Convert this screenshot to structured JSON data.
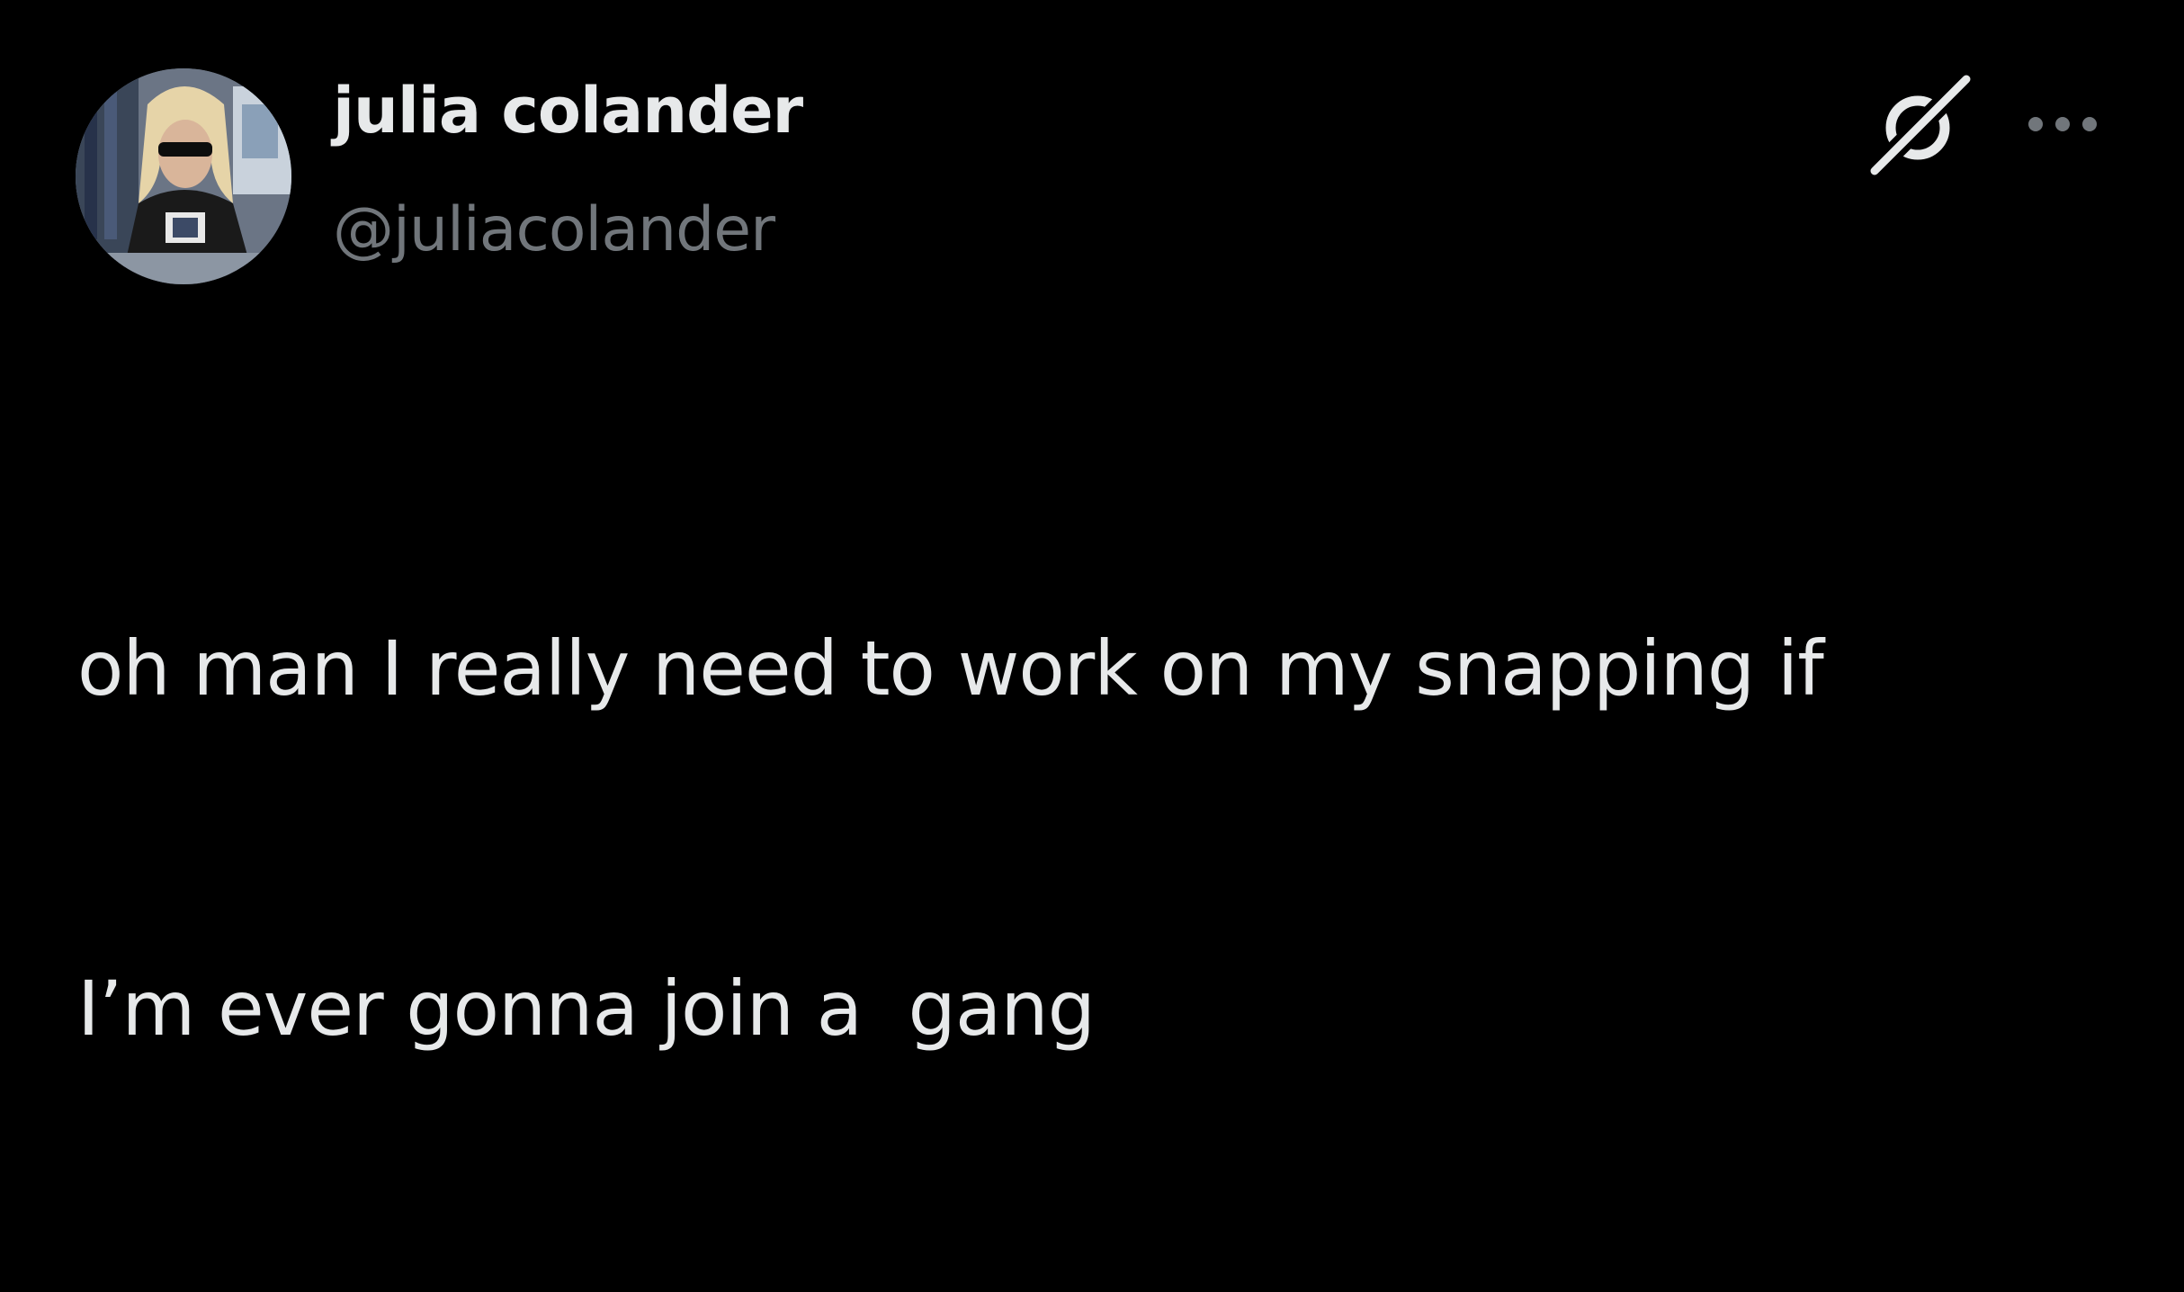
{
  "author": {
    "display_name": "julia colander",
    "handle": "@juliacolander",
    "avatar_icon": "profile-photo"
  },
  "actions": {
    "grok_icon": "grok-icon",
    "more_icon": "more-options-icon"
  },
  "tweet": {
    "text_lines": [
      "oh man I really need to work on my snapping if",
      "I’m ever gonna join a  gang"
    ]
  },
  "colors": {
    "background": "#000000",
    "primary_text": "#e7e9ea",
    "secondary_text": "#71767b"
  }
}
